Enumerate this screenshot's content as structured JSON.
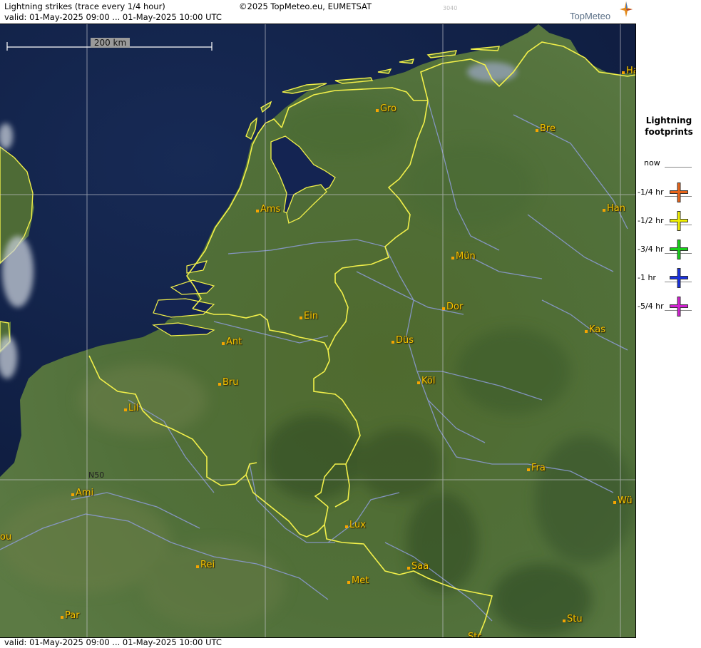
{
  "header": {
    "title": "Lightning strikes (trace every 1/4 hour)",
    "copyright": "©2025 TopMeteo.eu, EUMETSAT",
    "tile_id": "3040",
    "valid_top": "valid:  01-May-2025 09:00 ... 01-May-2025 10:00 UTC",
    "valid_bottom": "valid:  01-May-2025 09:00 ... 01-May-2025 10:00 UTC",
    "brand": "TopMeteo"
  },
  "map": {
    "scale_label": "200 km",
    "graticule_label": "N50",
    "cities": [
      {
        "key": "gro",
        "label": "Gro"
      },
      {
        "key": "bre",
        "label": "Bre"
      },
      {
        "key": "ham",
        "label": "Ha"
      },
      {
        "key": "ams",
        "label": "Ams"
      },
      {
        "key": "han",
        "label": "Han"
      },
      {
        "key": "mun",
        "label": "Mün"
      },
      {
        "key": "dor",
        "label": "Dor"
      },
      {
        "key": "ein",
        "label": "Ein"
      },
      {
        "key": "kas",
        "label": "Kas"
      },
      {
        "key": "ant",
        "label": "Ant"
      },
      {
        "key": "dus",
        "label": "Düs"
      },
      {
        "key": "bru",
        "label": "Bru"
      },
      {
        "key": "kol",
        "label": "Köl"
      },
      {
        "key": "lil",
        "label": "Lil"
      },
      {
        "key": "fra",
        "label": "Fra"
      },
      {
        "key": "ami",
        "label": "Ami"
      },
      {
        "key": "wur",
        "label": "Wü"
      },
      {
        "key": "lux",
        "label": "Lux"
      },
      {
        "key": "rou",
        "label": "ou"
      },
      {
        "key": "saa",
        "label": "Saa"
      },
      {
        "key": "rei",
        "label": "Rei"
      },
      {
        "key": "met",
        "label": "Met"
      },
      {
        "key": "par",
        "label": "Par"
      },
      {
        "key": "stu",
        "label": "Stu"
      },
      {
        "key": "str",
        "label": "Str"
      }
    ]
  },
  "legend": {
    "title_line1": "Lightning",
    "title_line2": "footprints",
    "entries": [
      {
        "time": "now"
      },
      {
        "time": "-1/4 hr",
        "color": "#e8641a",
        "icon": "orange-cross"
      },
      {
        "time": "-1/2 hr",
        "color": "#f0f000",
        "icon": "yellow-cross"
      },
      {
        "time": "-3/4 hr",
        "color": "#18d018",
        "icon": "green-cross"
      },
      {
        "time": "-1 hr",
        "color": "#1830e0",
        "icon": "blue-cross"
      },
      {
        "time": "-5/4 hr",
        "color": "#d020d0",
        "icon": "magenta-cross"
      }
    ]
  },
  "colors": {
    "border": "#f2f04a",
    "sea": "#14244e",
    "land": "#4d6a34",
    "river": "#8d9cd8"
  }
}
